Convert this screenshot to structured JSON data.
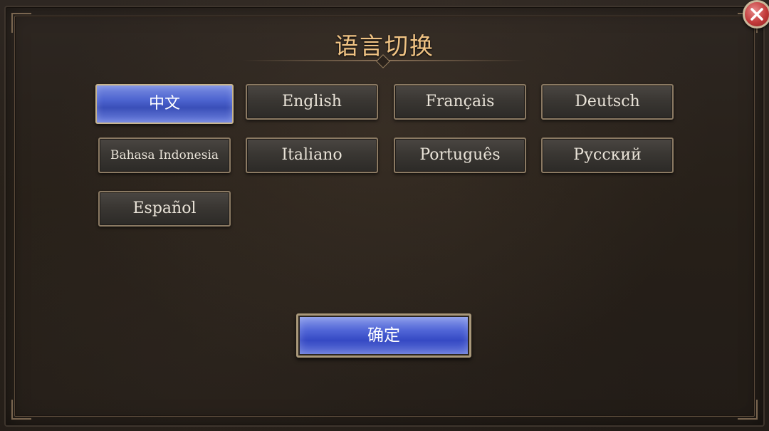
{
  "dialog": {
    "title": "语言切换"
  },
  "languages": [
    {
      "label": "中文",
      "selected": true
    },
    {
      "label": "English",
      "selected": false
    },
    {
      "label": "Français",
      "selected": false
    },
    {
      "label": "Deutsch",
      "selected": false
    },
    {
      "label": "Bahasa Indonesia",
      "selected": false
    },
    {
      "label": "Italiano",
      "selected": false
    },
    {
      "label": "Português",
      "selected": false
    },
    {
      "label": "Русский",
      "selected": false
    },
    {
      "label": "Español",
      "selected": false
    }
  ],
  "confirm": {
    "label": "确定"
  },
  "icons": {
    "close": "close-icon"
  },
  "colors": {
    "title": "#f0c384",
    "selected_button": "#4c63cf",
    "close_button": "#c23a3a"
  }
}
